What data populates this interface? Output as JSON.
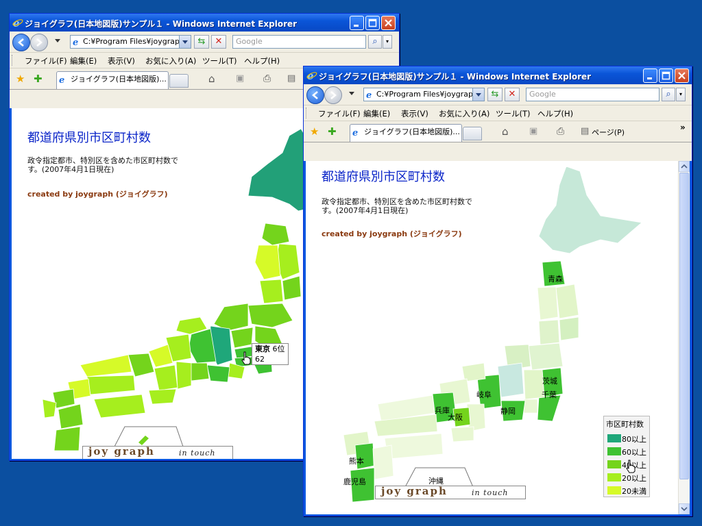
{
  "windows": [
    {
      "title": "ジョイグラフ(日本地図版)サンプル１ - Windows Internet Explorer",
      "address": "C:¥Program Files¥joygraph",
      "search_placeholder": "Google",
      "menu": [
        "ファイル(F)",
        "編集(E)",
        "表示(V)",
        "お気に入り(A)",
        "ツール(T)",
        "ヘルプ(H)"
      ],
      "tab_label": "ジョイグラフ(日本地図版)...",
      "page_heading": "都道府県別市区町村数",
      "page_desc": "政令指定都市、特別区を含めた市区町村数で す。(2007年4月1日現在)",
      "credit": "created by joygraph (ジョイグラフ)",
      "logo_main": "joy graph",
      "logo_sub": "in touch",
      "tooltip": {
        "pref": "東京",
        "rank": "6位",
        "value": "62"
      }
    },
    {
      "title": "ジョイグラフ(日本地図版)サンプル１ - Windows Internet Explorer",
      "address": "C:¥Program Files¥joygraph",
      "search_placeholder": "Google",
      "menu": [
        "ファイル(F)",
        "編集(E)",
        "表示(V)",
        "お気に入り(A)",
        "ツール(T)",
        "ヘルプ(H)"
      ],
      "tab_label": "ジョイグラフ(日本地図版)...",
      "page_menu": "ページ(P)",
      "page_heading": "都道府県別市区町村数",
      "page_desc": "政令指定都市、特別区を含めた市区町村数で す。(2007年4月1日現在)",
      "credit": "created by joygraph (ジョイグラフ)",
      "logo_main": "joy graph",
      "logo_sub": "in touch",
      "pref_labels": {
        "aomori": "青森",
        "ibaraki": "茨城",
        "chiba": "千葉",
        "gifu": "岐阜",
        "shizuoka": "静岡",
        "hyogo": "兵庫",
        "osaka": "大阪",
        "kumamoto": "熊本",
        "kagoshima": "鹿児島",
        "okinawa": "沖縄"
      },
      "legend": {
        "title": "市区町村数",
        "items": [
          {
            "label": "80以上",
            "color": "#1fa77a"
          },
          {
            "label": "60以上",
            "color": "#3fc232"
          },
          {
            "label": "40以上",
            "color": "#74d41c"
          },
          {
            "label": "20以上",
            "color": "#a6ee1e"
          },
          {
            "label": "20未満",
            "color": "#d6fa28"
          }
        ]
      }
    }
  ]
}
